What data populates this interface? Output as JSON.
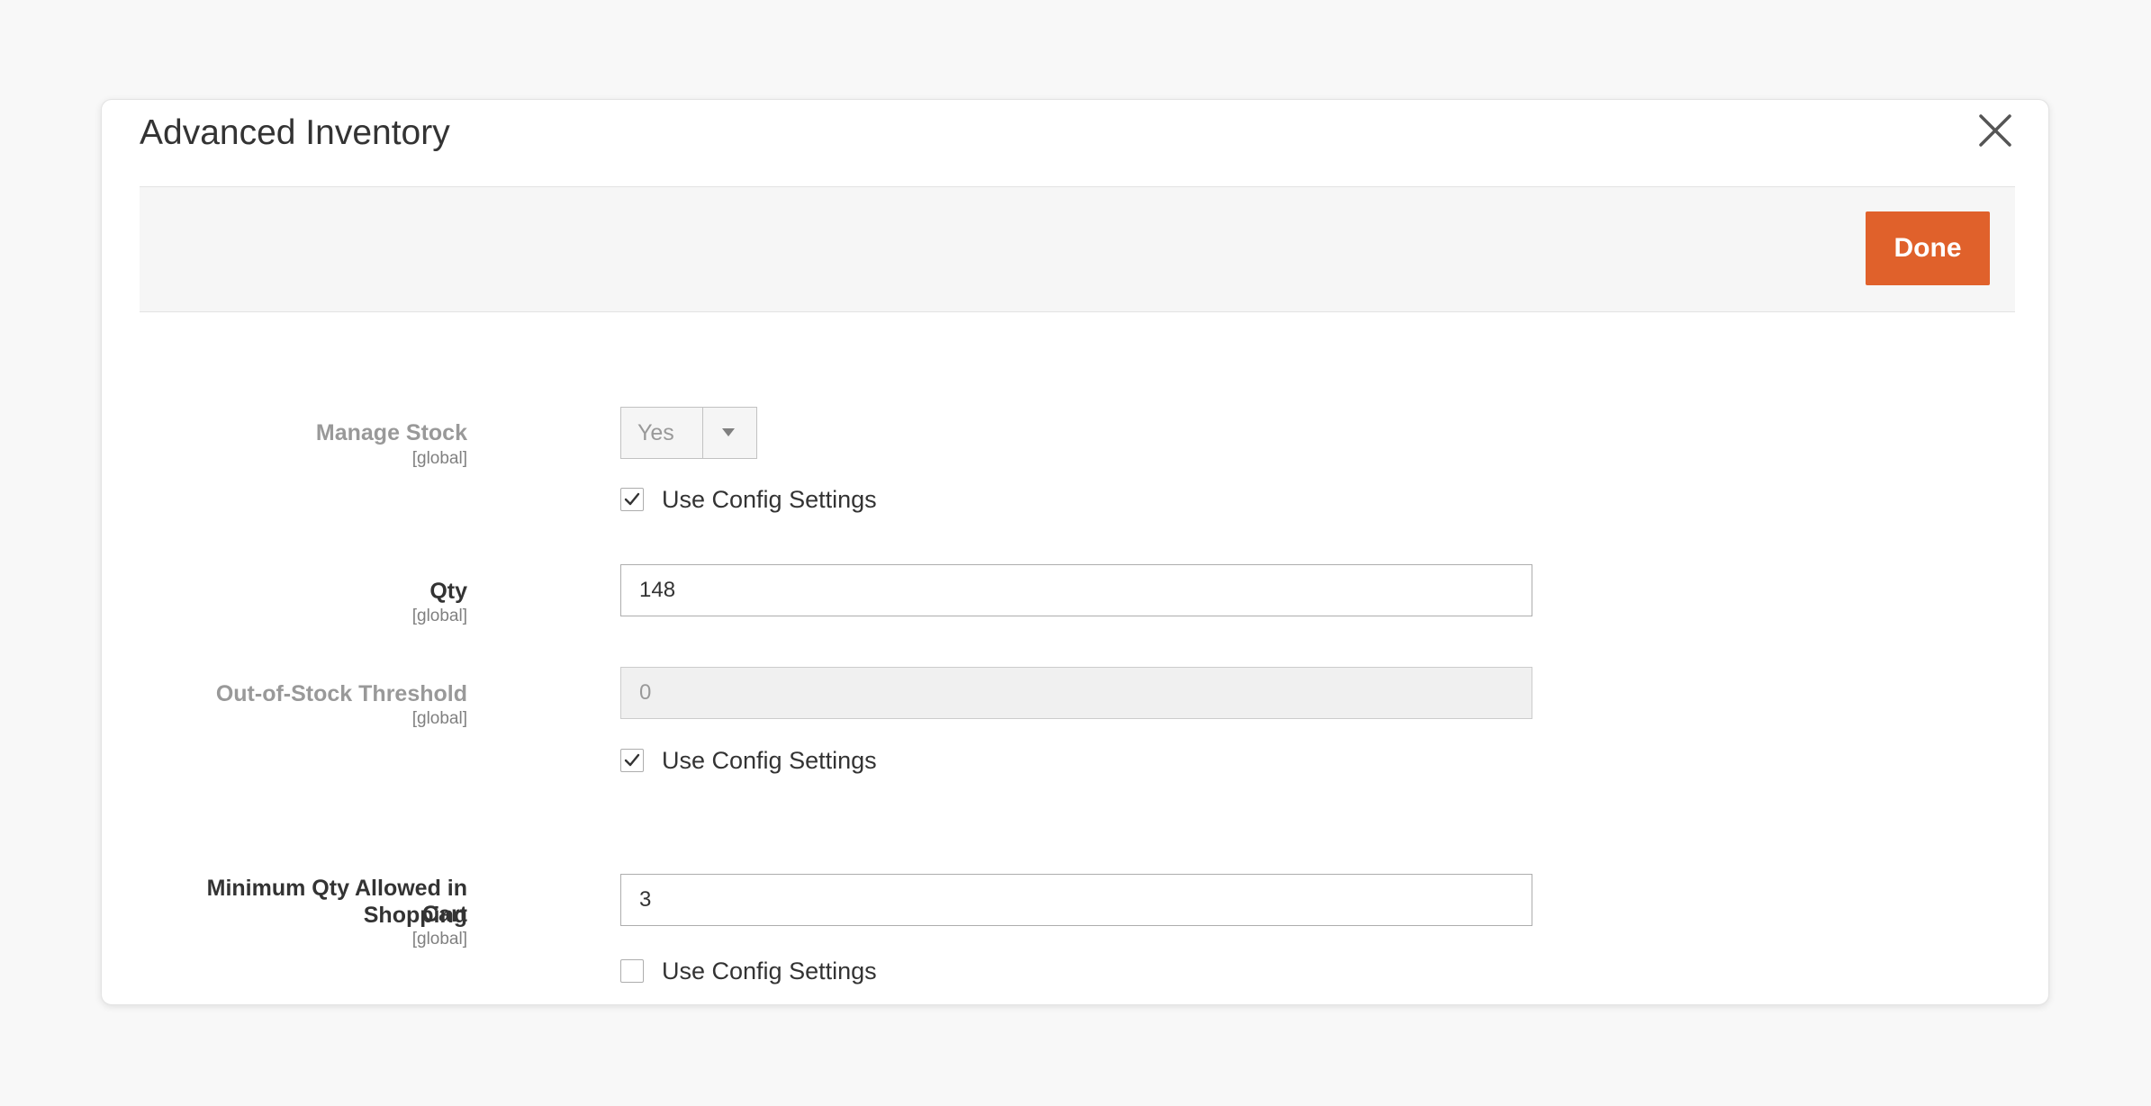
{
  "modal": {
    "title": "Advanced Inventory",
    "close_icon": "close-icon",
    "done_label": "Done"
  },
  "colors": {
    "accent": "#e0612b",
    "text": "#333333",
    "disabled_text": "#999999"
  },
  "fields": {
    "manage_stock": {
      "label": "Manage Stock",
      "scope": "[global]",
      "value": "Yes",
      "use_config_label": "Use Config Settings",
      "use_config_checked": true
    },
    "qty": {
      "label": "Qty",
      "scope": "[global]",
      "value": "148"
    },
    "out_of_stock_threshold": {
      "label": "Out-of-Stock Threshold",
      "scope": "[global]",
      "value": "0",
      "use_config_label": "Use Config Settings",
      "use_config_checked": true
    },
    "min_qty_cart": {
      "label_line1": "Minimum Qty Allowed in Shopping",
      "label_line2": "Cart",
      "scope": "[global]",
      "value": "3",
      "use_config_label": "Use Config Settings",
      "use_config_checked": false
    }
  }
}
